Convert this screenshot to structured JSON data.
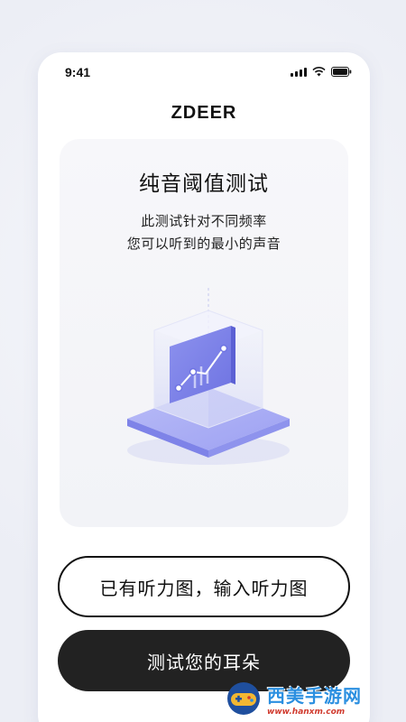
{
  "status_bar": {
    "time": "9:41",
    "icons": [
      "signal-icon",
      "wifi-icon",
      "battery-icon"
    ]
  },
  "header": {
    "app_title": "ZDEER"
  },
  "card": {
    "title": "纯音阈值测试",
    "description_line1": "此测试针对不同频率",
    "description_line2": "您可以听到的最小的声音",
    "illustration": "audiogram-cube-illustration"
  },
  "buttons": {
    "input_audiogram": "已有听力图，输入听力图",
    "test_ears": "测试您的耳朵"
  },
  "watermark": {
    "text": "西美手游网",
    "url": "www.hanxm.com"
  },
  "colors": {
    "accent": "#8a8ff0",
    "dark_button": "#222222",
    "background": "#eceef5"
  }
}
